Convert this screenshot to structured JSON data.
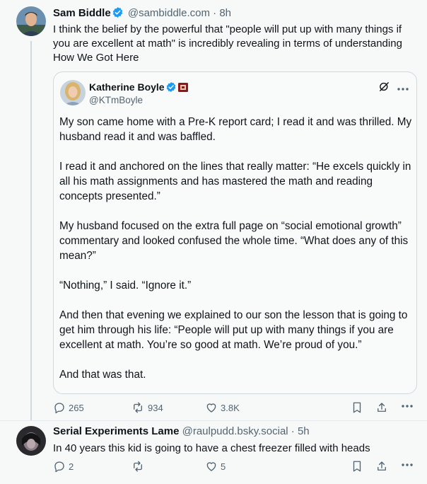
{
  "post1": {
    "author_name": "Sam Biddle",
    "handle": "@sambiddle.com",
    "separator": "·",
    "time": "8h",
    "text": "I think the belief by the powerful that \"people will put up with many things if you are excellent at math\" is incredibly revealing in terms of understanding How We Got Here",
    "quote": {
      "author_name": "Katherine Boyle",
      "handle": "@KTmBoyle",
      "paragraphs": [
        "My son came home with a Pre-K report card; I read it and was thrilled. My husband read it and was baffled.",
        "I read it and anchored on the lines that really matter: “He excels quickly in all his math assignments and has mastered the math and reading concepts presented.”",
        "My husband focused on the extra full page on “social emotional growth” commentary and looked confused the whole time. “What does any of this mean?”",
        "“Nothing,” I said. “Ignore it.”",
        "And then that evening we explained to our son the lesson that is going to get him through his life: “People will put up with many things if you are excellent at math. You’re so good at math. We’re proud of you.”",
        "And that was that."
      ]
    },
    "stats": {
      "replies": "265",
      "reposts": "934",
      "likes": "3.8K"
    }
  },
  "post2": {
    "author_name": "Serial Experiments Lame",
    "handle": "@raulpudd.bsky.social",
    "separator": "·",
    "time": "5h",
    "text": "In 40 years this kid is going to have a chest freezer filled with heads",
    "stats": {
      "replies": "2",
      "reposts": "",
      "likes": "5"
    }
  },
  "colors": {
    "verified": "#1d9bf0",
    "muted": "#536471",
    "border": "#cfd9de"
  },
  "icons": [
    "verified-badge-icon",
    "flag-badge-icon",
    "grok-icon",
    "more-icon",
    "reply-icon",
    "repost-icon",
    "like-icon",
    "bookmark-icon",
    "share-icon"
  ]
}
